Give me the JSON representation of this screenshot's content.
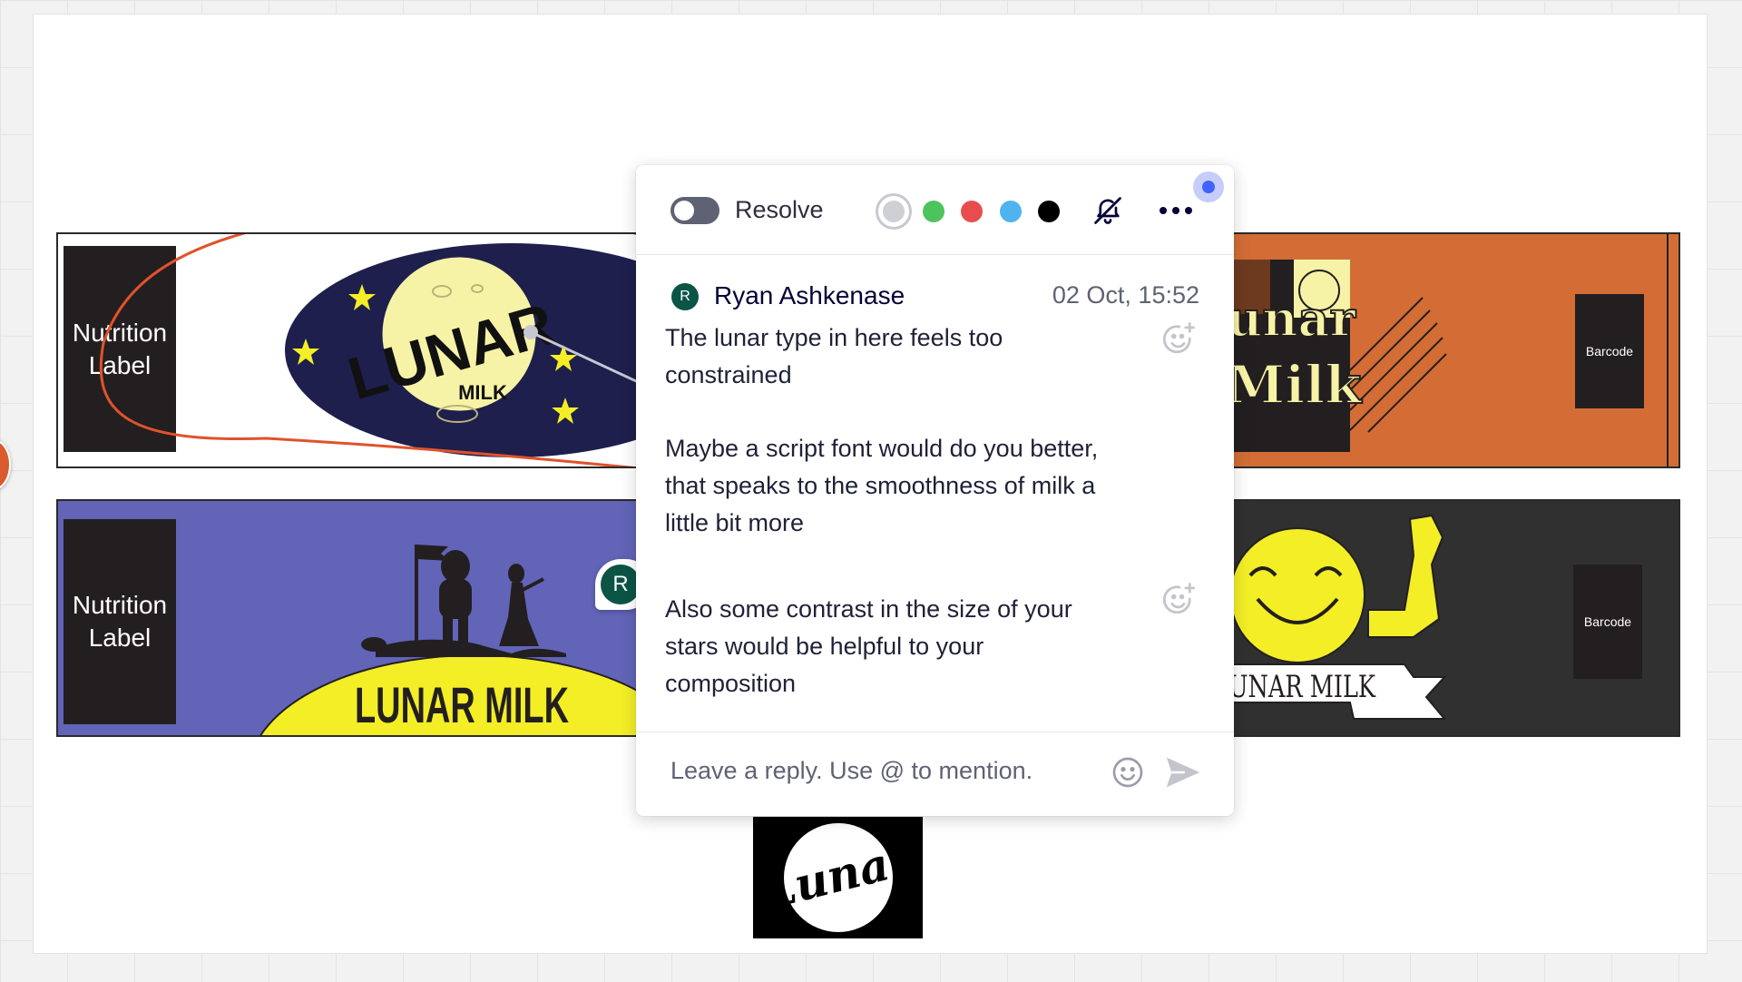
{
  "canvas": {
    "strips": {
      "top_left": {
        "nutrition_label": [
          "Nutrition",
          "Label"
        ],
        "logo_word": "LUNAR",
        "logo_sub": "MILK"
      },
      "top_right": {
        "logo_line1": "unar",
        "logo_line2": "Milk",
        "barcode_label": "Barcode"
      },
      "bottom_left": {
        "nutrition_label": [
          "Nutrition",
          "Label"
        ],
        "headline": "LUNAR MILK"
      },
      "bottom_right": {
        "headline": "UNAR MILK",
        "barcode_label": "Barcode"
      }
    },
    "avatar_pin_initial": "R",
    "script_logo_word": "Lunar"
  },
  "comment_panel": {
    "resolve_label": "Resolve",
    "resolve_checked": false,
    "color_swatches": [
      "#cfcfd6",
      "#4dc35d",
      "#e84d4d",
      "#4fb3f0",
      "#000000"
    ],
    "selected_swatch": 0,
    "header_icons": [
      "bell-off-icon",
      "more-icon"
    ],
    "author": {
      "initial": "R",
      "name": "Ryan Ashkenase"
    },
    "timestamp": "02 Oct, 15:52",
    "messages": [
      {
        "lines": [
          "The lunar type in here feels too",
          "constrained"
        ]
      },
      {
        "lines": [
          "Maybe a script font would do you better,",
          "that speaks to the smoothness of milk a",
          "little bit more"
        ]
      },
      {
        "lines": [
          "Also some contrast in the size of your",
          "stars would be helpful to your",
          "composition"
        ]
      }
    ],
    "reply_placeholder": "Leave a reply. Use @ to mention."
  },
  "colors": {
    "accent": "#4262ff",
    "annotation_stroke": "#e0532a",
    "navy_label": "#1e1f4d",
    "moon": "#f7f3a6",
    "orange_label": "#d36d35",
    "purple_label": "#6264b8",
    "dark_label": "#303030",
    "yellow": "#f3ee26"
  }
}
